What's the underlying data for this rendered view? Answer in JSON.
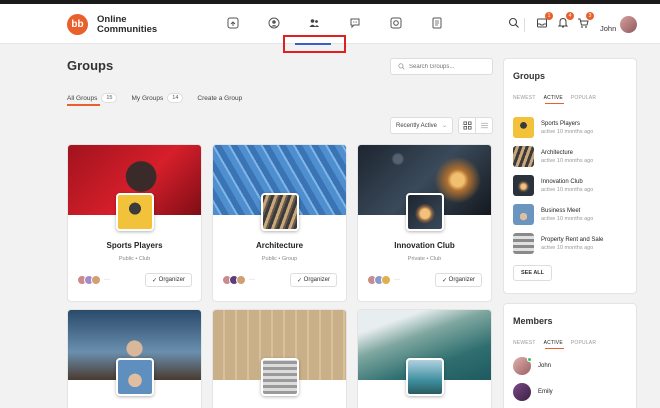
{
  "header": {
    "logo_mark": "bb",
    "logo_line1": "Online",
    "logo_line2": "Communities",
    "nav_icons": [
      "activity-icon",
      "profile-icon",
      "groups-icon",
      "messages-icon",
      "photos-icon",
      "documents-icon"
    ],
    "search_icon": "search-icon",
    "messages_badge": "1",
    "notifications_badge": "4",
    "cart_badge": "3",
    "username": "John"
  },
  "main": {
    "title": "Groups",
    "search_placeholder": "Search Groups...",
    "tabs": [
      {
        "label": "All Groups",
        "count": "15"
      },
      {
        "label": "My Groups",
        "count": "14"
      },
      {
        "label": "Create a Group",
        "count": ""
      }
    ],
    "sort_label": "Recently Active",
    "view_modes": [
      "grid-view-icon",
      "list-view-icon"
    ],
    "cards": [
      {
        "name": "Sports Players",
        "meta": "Public  •  Club",
        "button": "Organizer",
        "more": "···"
      },
      {
        "name": "Architecture",
        "meta": "Public  •  Group",
        "button": "Organizer",
        "more": "···"
      },
      {
        "name": "Innovation Club",
        "meta": "Private  •  Club",
        "button": "Organizer",
        "more": "···"
      }
    ]
  },
  "sidebar_groups": {
    "title": "Groups",
    "tabs": [
      "NEWEST",
      "ACTIVE",
      "POPULAR"
    ],
    "active_tab": "ACTIVE",
    "items": [
      {
        "name": "Sports Players",
        "sub": "active 10 months ago"
      },
      {
        "name": "Architecture",
        "sub": "active 10 months ago"
      },
      {
        "name": "Innovation Club",
        "sub": "active 10 months ago"
      },
      {
        "name": "Business Meet",
        "sub": "active 10 months ago"
      },
      {
        "name": "Property Rent and Sale",
        "sub": "active 10 months ago"
      }
    ],
    "see_all": "SEE ALL"
  },
  "sidebar_members": {
    "title": "Members",
    "tabs": [
      "NEWEST",
      "ACTIVE",
      "POPULAR"
    ],
    "active_tab": "ACTIVE",
    "items": [
      {
        "name": "John"
      },
      {
        "name": "Emily"
      }
    ]
  },
  "colors": {
    "accent": "#e8612c",
    "nav_active": "#3b5fc4",
    "annotation": "#e02020"
  }
}
